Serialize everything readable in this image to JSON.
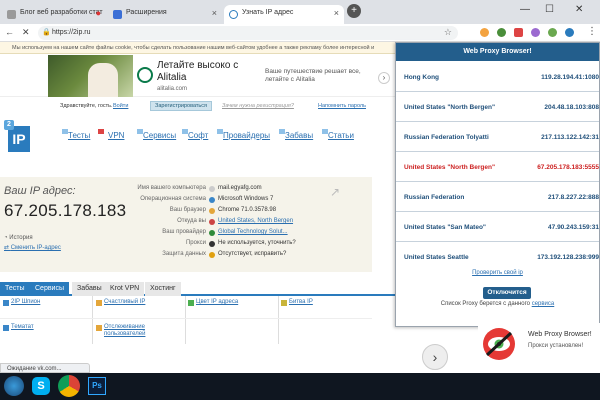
{
  "browser": {
    "tabs": [
      {
        "label": "Блог веб разработки стат"
      },
      {
        "label": "Расширения"
      },
      {
        "label": "Узнать IP адрес"
      }
    ],
    "new_tab": "+",
    "win_controls": [
      "—",
      "☐",
      "✕"
    ],
    "url": "https://2ip.ru",
    "reload": "✕",
    "star": "☆",
    "menu": "⋮"
  },
  "infobar": {
    "text": "Мы используем на нашем сайте файлы cookie, чтобы сделать пользование нашим веб-сайтом удобнее а также рекламу более интересной и"
  },
  "ad": {
    "title": "Летайте высоко с Alitalia",
    "domain": "alitalia.com",
    "side_text": "Ваше путешествие решает все, летайте с Alitalia",
    "next": "›"
  },
  "userbar": {
    "greeting": "Здравствуйте, гость.",
    "login": "Войти",
    "register": "Зарегистрироваться",
    "why": "Зачем нужна регистрация?",
    "forgot": "Напомнить пароль"
  },
  "logo": {
    "two": "2",
    "ip": "IP"
  },
  "nav": [
    "Тесты",
    "VPN",
    "Сервисы",
    "Софт",
    "Провайдеры",
    "Забавы",
    "Статьи"
  ],
  "ipinfo": {
    "label": "Ваш IP адрес:",
    "value": "67.205.178.183",
    "history": "История",
    "change": "Сменить IP-адрес",
    "rows": [
      {
        "k": "Имя вашего компьютера",
        "v": "mail.egyafg.com",
        "color": "#e8e8e8"
      },
      {
        "k": "Операционная система",
        "v": "Microsoft Windows 7",
        "color": "#3a86c8"
      },
      {
        "k": "Ваш браузер",
        "v": "Chrome 71.0.3578.98",
        "color": "#e4a63a"
      },
      {
        "k": "Откуда вы",
        "v": "United States, North Bergen",
        "color": "#c44",
        "link": true
      },
      {
        "k": "Ваш провайдер",
        "v": "Global Technology Solut...",
        "color": "#2f8a3a",
        "link": true
      },
      {
        "k": "Прокси",
        "v": "Не используется, уточнить?",
        "color": "#333"
      },
      {
        "k": "Защита данных",
        "v": "Отсутствует, исправить?",
        "color": "#e0a010"
      }
    ]
  },
  "tabs2": [
    "Тесты",
    "Сервисы",
    "Забавы",
    "Krot VPN",
    "Хостинг"
  ],
  "services": [
    {
      "label": "2IP Шпион",
      "color": "#3a86c8"
    },
    {
      "label": "Счастливый IP",
      "color": "#e4a63a"
    },
    {
      "label": "Цвет IP адреса",
      "color": "#4caf50"
    },
    {
      "label": "Битва IP",
      "color": "#c8b43a"
    },
    {
      "label": "Тематат",
      "color": "#3a86c8"
    },
    {
      "label": "Отслеживание пользователей",
      "color": "#e4a63a"
    }
  ],
  "status": "Ожидание vk.com...",
  "popup": {
    "title": "Web Proxy Browser!",
    "proxies": [
      {
        "country": "Hong Kong",
        "address": "119.28.194.41:1080"
      },
      {
        "country": "United States \"North Bergen\"",
        "address": "204.48.18.103:808"
      },
      {
        "country": "Russian Federation Tolyatti",
        "address": "217.113.122.142:31"
      },
      {
        "country": "United States \"North Bergen\"",
        "address": "67.205.178.183:5555",
        "active": true
      },
      {
        "country": "Russian Federation",
        "address": "217.8.227.22:888"
      },
      {
        "country": "United States \"San Mateo\"",
        "address": "47.90.243.159:31"
      },
      {
        "country": "United States Seattle",
        "address": "173.192.128.238:999"
      }
    ],
    "check_ip": "Проверить свой ip",
    "disconnect": "Отключится",
    "source_prefix": "Список Proxy берется с данного",
    "source_link": "сервиса"
  },
  "notification": {
    "title": "Web Proxy Browser!",
    "subtitle": "Прокси установлен!"
  },
  "next_round": "›"
}
